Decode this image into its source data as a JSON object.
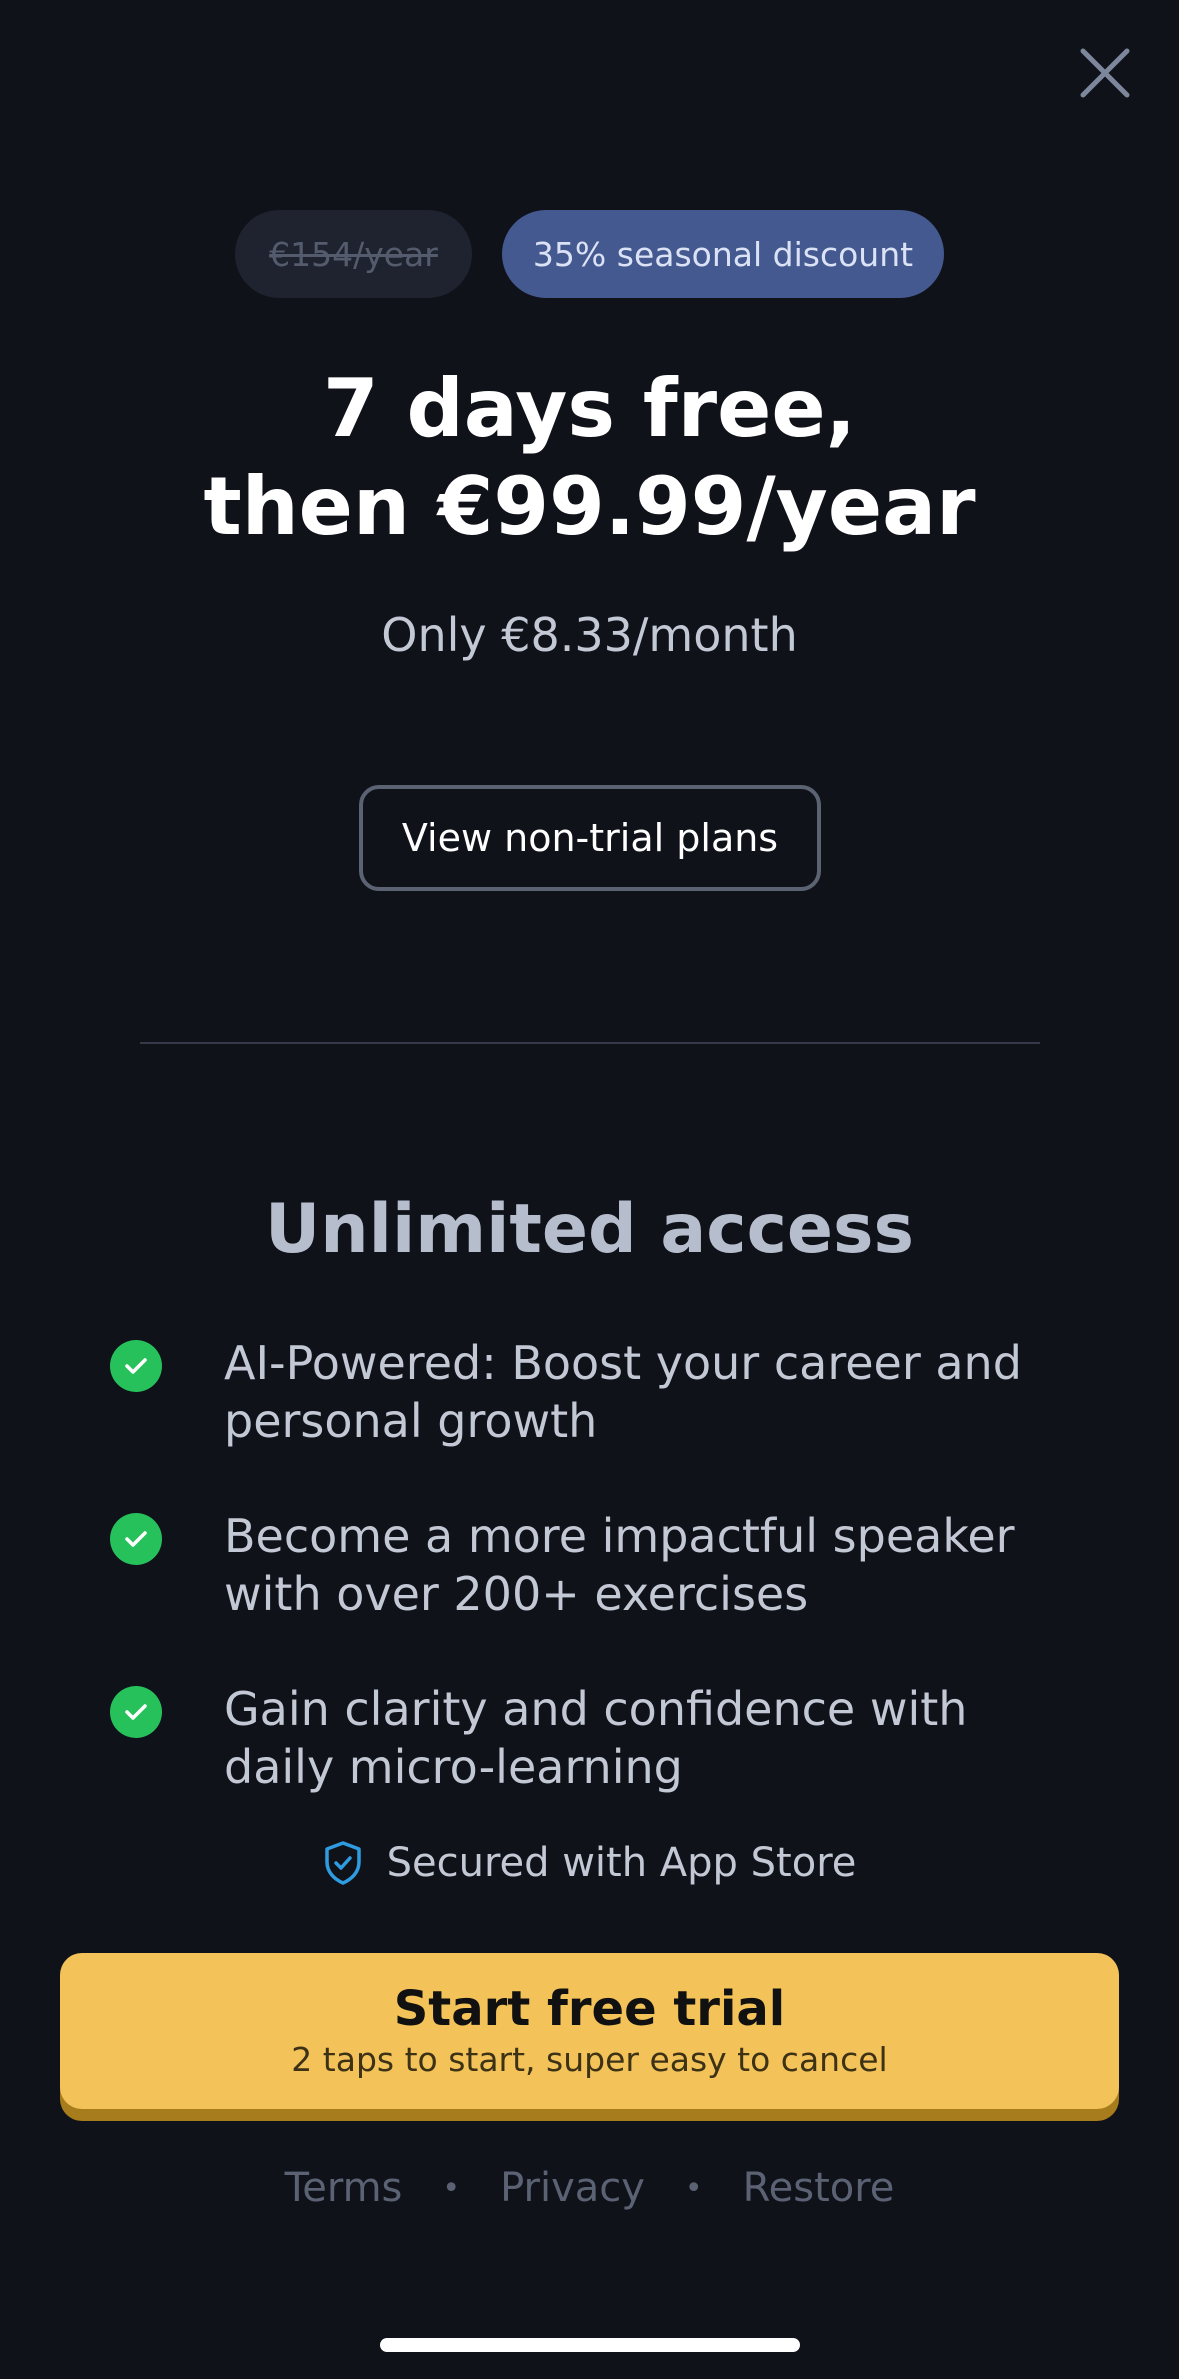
{
  "close": {
    "icon": "close-icon"
  },
  "badges": {
    "old_price": "€154/year",
    "discount": "35% seasonal discount"
  },
  "headline": {
    "line1": "7 days free,",
    "line2": "then €99.99/year"
  },
  "subprice": "Only €8.33/month",
  "nontrial_button": "View non-trial plans",
  "section_title": "Unlimited access",
  "features": [
    {
      "line1": "AI-Powered: Boost your career and",
      "line2": "personal growth"
    },
    {
      "line1": "Become a more impactful speaker",
      "line2": "with over 200+ exercises"
    },
    {
      "line1": "Gain clarity and confidence with",
      "line2": "daily micro-learning"
    }
  ],
  "secured": {
    "icon": "shield-check-icon",
    "text": "Secured with App Store"
  },
  "cta": {
    "title": "Start free trial",
    "subtitle": "2 taps to start, super easy to cancel"
  },
  "footer": {
    "terms": "Terms",
    "privacy": "Privacy",
    "restore": "Restore",
    "separator": "•"
  },
  "colors": {
    "background": "#10121a",
    "discount_badge": "#44598f",
    "check": "#27c15c",
    "cta": "#f3c359",
    "shield": "#2f9be0"
  }
}
